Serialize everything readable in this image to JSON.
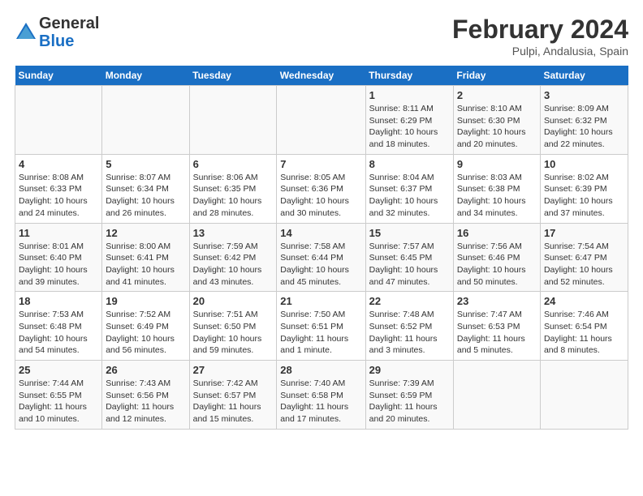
{
  "logo": {
    "general": "General",
    "blue": "Blue"
  },
  "title": "February 2024",
  "location": "Pulpi, Andalusia, Spain",
  "days_header": [
    "Sunday",
    "Monday",
    "Tuesday",
    "Wednesday",
    "Thursday",
    "Friday",
    "Saturday"
  ],
  "weeks": [
    [
      {
        "num": "",
        "info": ""
      },
      {
        "num": "",
        "info": ""
      },
      {
        "num": "",
        "info": ""
      },
      {
        "num": "",
        "info": ""
      },
      {
        "num": "1",
        "info": "Sunrise: 8:11 AM\nSunset: 6:29 PM\nDaylight: 10 hours\nand 18 minutes."
      },
      {
        "num": "2",
        "info": "Sunrise: 8:10 AM\nSunset: 6:30 PM\nDaylight: 10 hours\nand 20 minutes."
      },
      {
        "num": "3",
        "info": "Sunrise: 8:09 AM\nSunset: 6:32 PM\nDaylight: 10 hours\nand 22 minutes."
      }
    ],
    [
      {
        "num": "4",
        "info": "Sunrise: 8:08 AM\nSunset: 6:33 PM\nDaylight: 10 hours\nand 24 minutes."
      },
      {
        "num": "5",
        "info": "Sunrise: 8:07 AM\nSunset: 6:34 PM\nDaylight: 10 hours\nand 26 minutes."
      },
      {
        "num": "6",
        "info": "Sunrise: 8:06 AM\nSunset: 6:35 PM\nDaylight: 10 hours\nand 28 minutes."
      },
      {
        "num": "7",
        "info": "Sunrise: 8:05 AM\nSunset: 6:36 PM\nDaylight: 10 hours\nand 30 minutes."
      },
      {
        "num": "8",
        "info": "Sunrise: 8:04 AM\nSunset: 6:37 PM\nDaylight: 10 hours\nand 32 minutes."
      },
      {
        "num": "9",
        "info": "Sunrise: 8:03 AM\nSunset: 6:38 PM\nDaylight: 10 hours\nand 34 minutes."
      },
      {
        "num": "10",
        "info": "Sunrise: 8:02 AM\nSunset: 6:39 PM\nDaylight: 10 hours\nand 37 minutes."
      }
    ],
    [
      {
        "num": "11",
        "info": "Sunrise: 8:01 AM\nSunset: 6:40 PM\nDaylight: 10 hours\nand 39 minutes."
      },
      {
        "num": "12",
        "info": "Sunrise: 8:00 AM\nSunset: 6:41 PM\nDaylight: 10 hours\nand 41 minutes."
      },
      {
        "num": "13",
        "info": "Sunrise: 7:59 AM\nSunset: 6:42 PM\nDaylight: 10 hours\nand 43 minutes."
      },
      {
        "num": "14",
        "info": "Sunrise: 7:58 AM\nSunset: 6:44 PM\nDaylight: 10 hours\nand 45 minutes."
      },
      {
        "num": "15",
        "info": "Sunrise: 7:57 AM\nSunset: 6:45 PM\nDaylight: 10 hours\nand 47 minutes."
      },
      {
        "num": "16",
        "info": "Sunrise: 7:56 AM\nSunset: 6:46 PM\nDaylight: 10 hours\nand 50 minutes."
      },
      {
        "num": "17",
        "info": "Sunrise: 7:54 AM\nSunset: 6:47 PM\nDaylight: 10 hours\nand 52 minutes."
      }
    ],
    [
      {
        "num": "18",
        "info": "Sunrise: 7:53 AM\nSunset: 6:48 PM\nDaylight: 10 hours\nand 54 minutes."
      },
      {
        "num": "19",
        "info": "Sunrise: 7:52 AM\nSunset: 6:49 PM\nDaylight: 10 hours\nand 56 minutes."
      },
      {
        "num": "20",
        "info": "Sunrise: 7:51 AM\nSunset: 6:50 PM\nDaylight: 10 hours\nand 59 minutes."
      },
      {
        "num": "21",
        "info": "Sunrise: 7:50 AM\nSunset: 6:51 PM\nDaylight: 11 hours\nand 1 minute."
      },
      {
        "num": "22",
        "info": "Sunrise: 7:48 AM\nSunset: 6:52 PM\nDaylight: 11 hours\nand 3 minutes."
      },
      {
        "num": "23",
        "info": "Sunrise: 7:47 AM\nSunset: 6:53 PM\nDaylight: 11 hours\nand 5 minutes."
      },
      {
        "num": "24",
        "info": "Sunrise: 7:46 AM\nSunset: 6:54 PM\nDaylight: 11 hours\nand 8 minutes."
      }
    ],
    [
      {
        "num": "25",
        "info": "Sunrise: 7:44 AM\nSunset: 6:55 PM\nDaylight: 11 hours\nand 10 minutes."
      },
      {
        "num": "26",
        "info": "Sunrise: 7:43 AM\nSunset: 6:56 PM\nDaylight: 11 hours\nand 12 minutes."
      },
      {
        "num": "27",
        "info": "Sunrise: 7:42 AM\nSunset: 6:57 PM\nDaylight: 11 hours\nand 15 minutes."
      },
      {
        "num": "28",
        "info": "Sunrise: 7:40 AM\nSunset: 6:58 PM\nDaylight: 11 hours\nand 17 minutes."
      },
      {
        "num": "29",
        "info": "Sunrise: 7:39 AM\nSunset: 6:59 PM\nDaylight: 11 hours\nand 20 minutes."
      },
      {
        "num": "",
        "info": ""
      },
      {
        "num": "",
        "info": ""
      }
    ]
  ]
}
